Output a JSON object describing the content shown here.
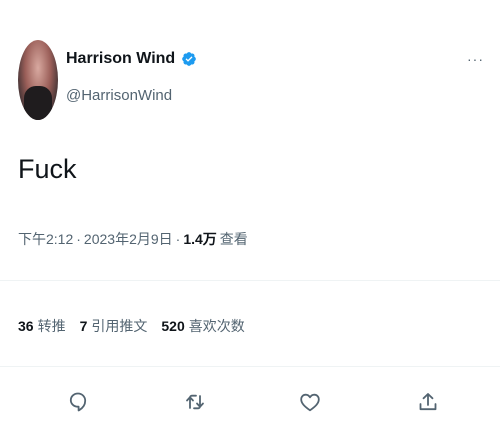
{
  "author": {
    "display_name": "Harrison Wind",
    "handle": "@HarrisonWind",
    "verified": true
  },
  "tweet": {
    "text": "Fuck",
    "time": "下午2:12",
    "sep1": "·",
    "date": "2023年2月9日",
    "sep2": "·",
    "views_count": "1.4万",
    "views_label": "查看"
  },
  "stats": {
    "retweets": {
      "count": "36",
      "label": "转推"
    },
    "quotes": {
      "count": "7",
      "label": "引用推文"
    },
    "likes": {
      "count": "520",
      "label": "喜欢次数"
    }
  },
  "more_label": "···",
  "colors": {
    "verified": "#1d9bf0",
    "secondary_text": "#536471",
    "primary_text": "#0f1419"
  },
  "icons": [
    "reply-icon",
    "retweet-icon",
    "like-icon",
    "share-icon",
    "verified-badge-icon",
    "more-icon"
  ]
}
